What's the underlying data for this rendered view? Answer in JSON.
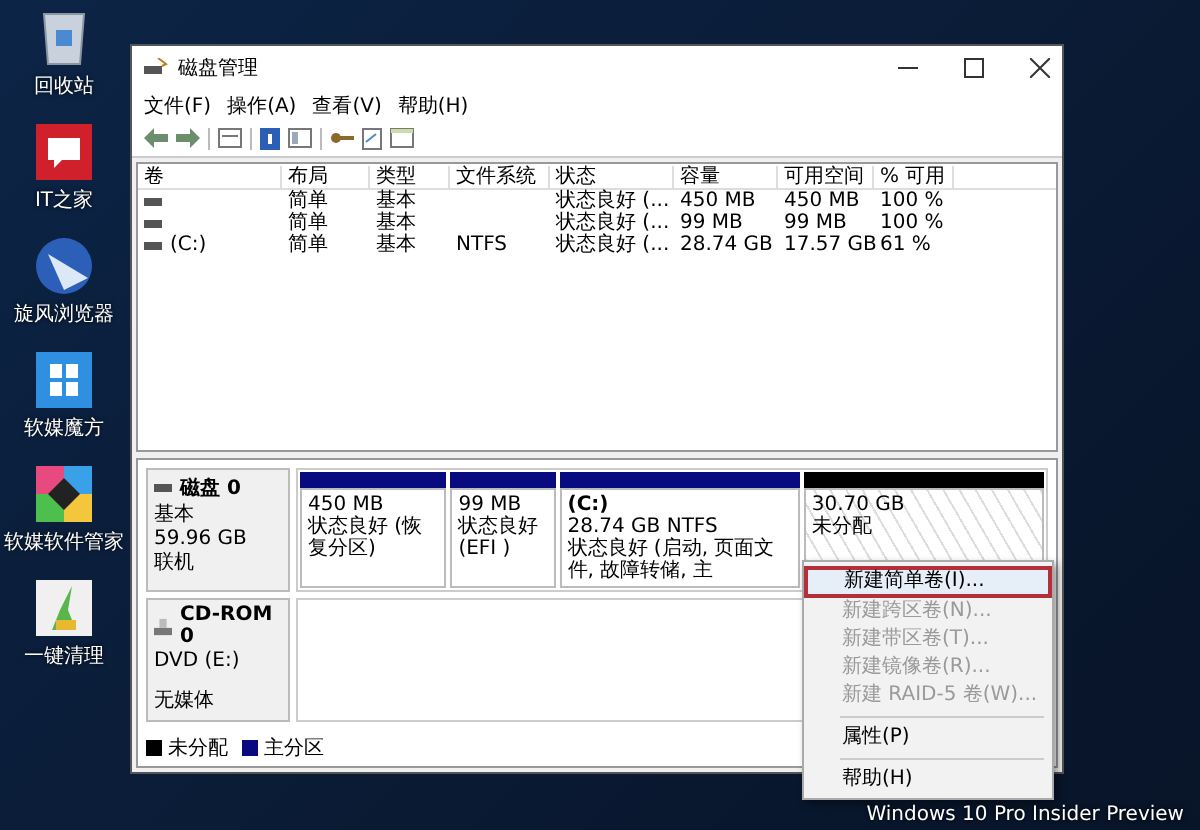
{
  "desktop_icons": [
    {
      "kind": "trash",
      "label": "回收站"
    },
    {
      "kind": "bubble",
      "label": "IT之家"
    },
    {
      "kind": "sweep",
      "label": "旋风浏览器"
    },
    {
      "kind": "grid",
      "label": "软媒魔方"
    },
    {
      "kind": "diamond",
      "label": "软媒软件管家"
    },
    {
      "kind": "broom",
      "label": "一键清理"
    }
  ],
  "window": {
    "title": "磁盘管理"
  },
  "menu": [
    "文件(F)",
    "操作(A)",
    "查看(V)",
    "帮助(H)"
  ],
  "table": {
    "columns": [
      "卷",
      "布局",
      "类型",
      "文件系统",
      "状态",
      "容量",
      "可用空间",
      "% 可用"
    ],
    "rows": [
      [
        "",
        "简单",
        "基本",
        "",
        "状态良好 (...",
        "450 MB",
        "450 MB",
        "100 %"
      ],
      [
        "",
        "简单",
        "基本",
        "",
        "状态良好 (...",
        "99 MB",
        "99 MB",
        "100 %"
      ],
      [
        "(C:)",
        "简单",
        "基本",
        "NTFS",
        "状态良好 (...",
        "28.74 GB",
        "17.57 GB",
        "61 %"
      ]
    ]
  },
  "disks": [
    {
      "kind": "disk",
      "name": "磁盘 0",
      "lines": [
        "基本",
        "59.96 GB",
        "联机"
      ],
      "partitions": [
        {
          "kind": "primary",
          "color": "#0a0a80",
          "size": "450 MB",
          "status": "状态良好 (恢复分区)"
        },
        {
          "kind": "primary",
          "color": "#0a0a80",
          "size": "99 MB",
          "status": "状态良好 (EFI )"
        },
        {
          "kind": "primary",
          "color": "#0a0a80",
          "label": "(C:)",
          "size": "28.74 GB NTFS",
          "status": "状态良好 (启动, 页面文件, 故障转储, 主"
        },
        {
          "kind": "unallocated",
          "color": "#000000",
          "size": "30.70 GB",
          "status": "未分配"
        }
      ]
    },
    {
      "kind": "cdrom",
      "name": "CD-ROM 0",
      "lines": [
        "DVD (E:)",
        "无媒体"
      ]
    }
  ],
  "legend": [
    {
      "label": "未分配",
      "color": "#000000"
    },
    {
      "label": "主分区",
      "color": "#0a0a80"
    }
  ],
  "context_menu": [
    {
      "items": [
        {
          "label": "新建简单卷(I)...",
          "selected": true,
          "disabled": false
        },
        {
          "label": "新建跨区卷(N)...",
          "selected": false,
          "disabled": true
        },
        {
          "label": "新建带区卷(T)...",
          "selected": false,
          "disabled": true
        },
        {
          "label": "新建镜像卷(R)...",
          "selected": false,
          "disabled": true
        },
        {
          "label": "新建 RAID-5 卷(W)...",
          "selected": false,
          "disabled": true
        }
      ]
    },
    {
      "items": [
        {
          "label": "属性(P)",
          "selected": false,
          "disabled": false
        }
      ]
    },
    {
      "items": [
        {
          "label": "帮助(H)",
          "selected": false,
          "disabled": false
        }
      ]
    }
  ],
  "os_edition": "Windows 10 Pro Insider Preview"
}
